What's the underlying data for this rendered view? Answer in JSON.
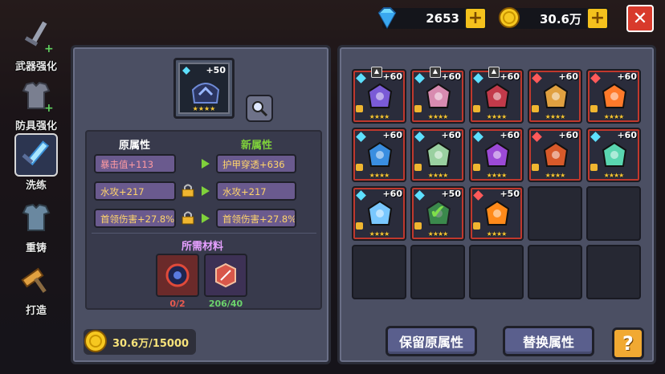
{
  "resources": {
    "gems": "2653",
    "coins": "30.6万"
  },
  "sidebar": [
    {
      "label": "武器强化",
      "icon": "sword-icon"
    },
    {
      "label": "防具强化",
      "icon": "armor-icon"
    },
    {
      "label": "洗练",
      "icon": "refine-icon",
      "active": true
    },
    {
      "label": "重铸",
      "icon": "reforge-icon"
    },
    {
      "label": "打造",
      "icon": "hammer-icon"
    }
  ],
  "item": {
    "level": "+50",
    "stars": "★★★★"
  },
  "headers": {
    "original": "原属性",
    "new": "新属性",
    "materials": "所需材料"
  },
  "attributes": {
    "original": [
      "暴击值+113",
      "水攻+217",
      "首领伤害+27.8%"
    ],
    "new": [
      "护甲穿透+636",
      "水攻+217",
      "首领伤害+27.8%"
    ]
  },
  "materials": [
    {
      "count": "0/2",
      "color": "#e85a4f"
    },
    {
      "count": "206/40",
      "color": "#6cd36c"
    }
  ],
  "cost": "30.6万/15000",
  "grid_items": [
    {
      "lv": "+60",
      "badge": true,
      "gem": "#5de0ff",
      "color": "#7a5bd6"
    },
    {
      "lv": "+60",
      "badge": true,
      "gem": "#5de0ff",
      "color": "#d88bb0"
    },
    {
      "lv": "+60",
      "badge": true,
      "gem": "#5de0ff",
      "color": "#c23a4a"
    },
    {
      "lv": "+60",
      "badge": false,
      "gem": "#ff5a5a",
      "color": "#e0a040"
    },
    {
      "lv": "+60",
      "badge": false,
      "gem": "#ff5a5a",
      "color": "#ff7a2a"
    },
    {
      "lv": "+60",
      "badge": false,
      "gem": "#5de0ff",
      "color": "#3a8ee0"
    },
    {
      "lv": "+60",
      "badge": false,
      "gem": "#5de0ff",
      "color": "#9ad0a0"
    },
    {
      "lv": "+60",
      "badge": false,
      "gem": "#5de0ff",
      "color": "#9c4ad6"
    },
    {
      "lv": "+60",
      "badge": false,
      "gem": "#ff5a5a",
      "color": "#d85a2a"
    },
    {
      "lv": "+60",
      "badge": false,
      "gem": "#5de0ff",
      "color": "#5ad6b0"
    },
    {
      "lv": "+60",
      "badge": false,
      "gem": "#5de0ff",
      "color": "#7ac8ff"
    },
    {
      "lv": "+50",
      "badge": false,
      "gem": "#5de0ff",
      "color": "#4ad65a",
      "dim": true
    },
    {
      "lv": "+50",
      "badge": false,
      "gem": "#ff5a5a",
      "color": "#ff8a1a"
    }
  ],
  "buttons": {
    "keep": "保留原属性",
    "replace": "替换属性",
    "help": "?"
  }
}
